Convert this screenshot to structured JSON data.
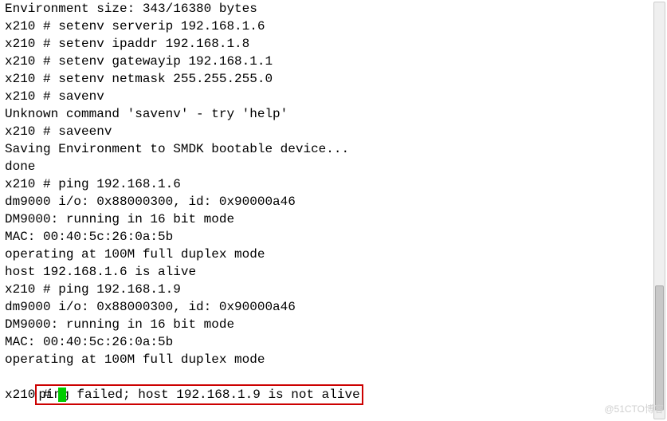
{
  "terminal": {
    "lines": [
      "Environment size: 343/16380 bytes",
      "x210 # setenv serverip 192.168.1.6",
      "x210 # setenv ipaddr 192.168.1.8",
      "x210 # setenv gatewayip 192.168.1.1",
      "x210 # setenv netmask 255.255.255.0",
      "x210 # savenv",
      "Unknown command 'savenv' - try 'help'",
      "x210 # saveenv",
      "Saving Environment to SMDK bootable device... ",
      "done",
      "x210 # ping 192.168.1.6",
      "dm9000 i/o: 0x88000300, id: 0x90000a46 ",
      "DM9000: running in 16 bit mode",
      "MAC: 00:40:5c:26:0a:5b",
      "operating at 100M full duplex mode",
      "host 192.168.1.6 is alive",
      "x210 # ping 192.168.1.9",
      "dm9000 i/o: 0x88000300, id: 0x90000a46 ",
      "DM9000: running in 16 bit mode",
      "MAC: 00:40:5c:26:0a:5b",
      "operating at 100M full duplex mode"
    ],
    "highlighted_line": "ping failed; host 192.168.1.9 is not alive",
    "prompt": "x210 # "
  },
  "watermark": "@51CTO博客"
}
